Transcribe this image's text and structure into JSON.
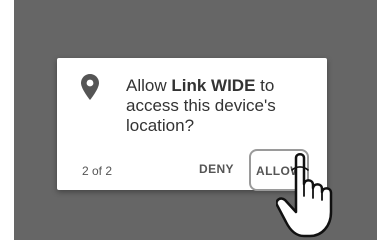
{
  "permission_dialog": {
    "message_prefix": "Allow ",
    "app_name": "Link WIDE",
    "message_suffix": " to access this device's location?",
    "counter": "2 of 2",
    "deny_label": "DENY",
    "allow_label": "ALLOW"
  },
  "icons": {
    "location": "location-pin-icon",
    "pointer": "hand-pointer-icon"
  },
  "colors": {
    "backdrop": "#666666",
    "dialog": "#ffffff",
    "text": "#333333",
    "button_text": "#555555"
  }
}
